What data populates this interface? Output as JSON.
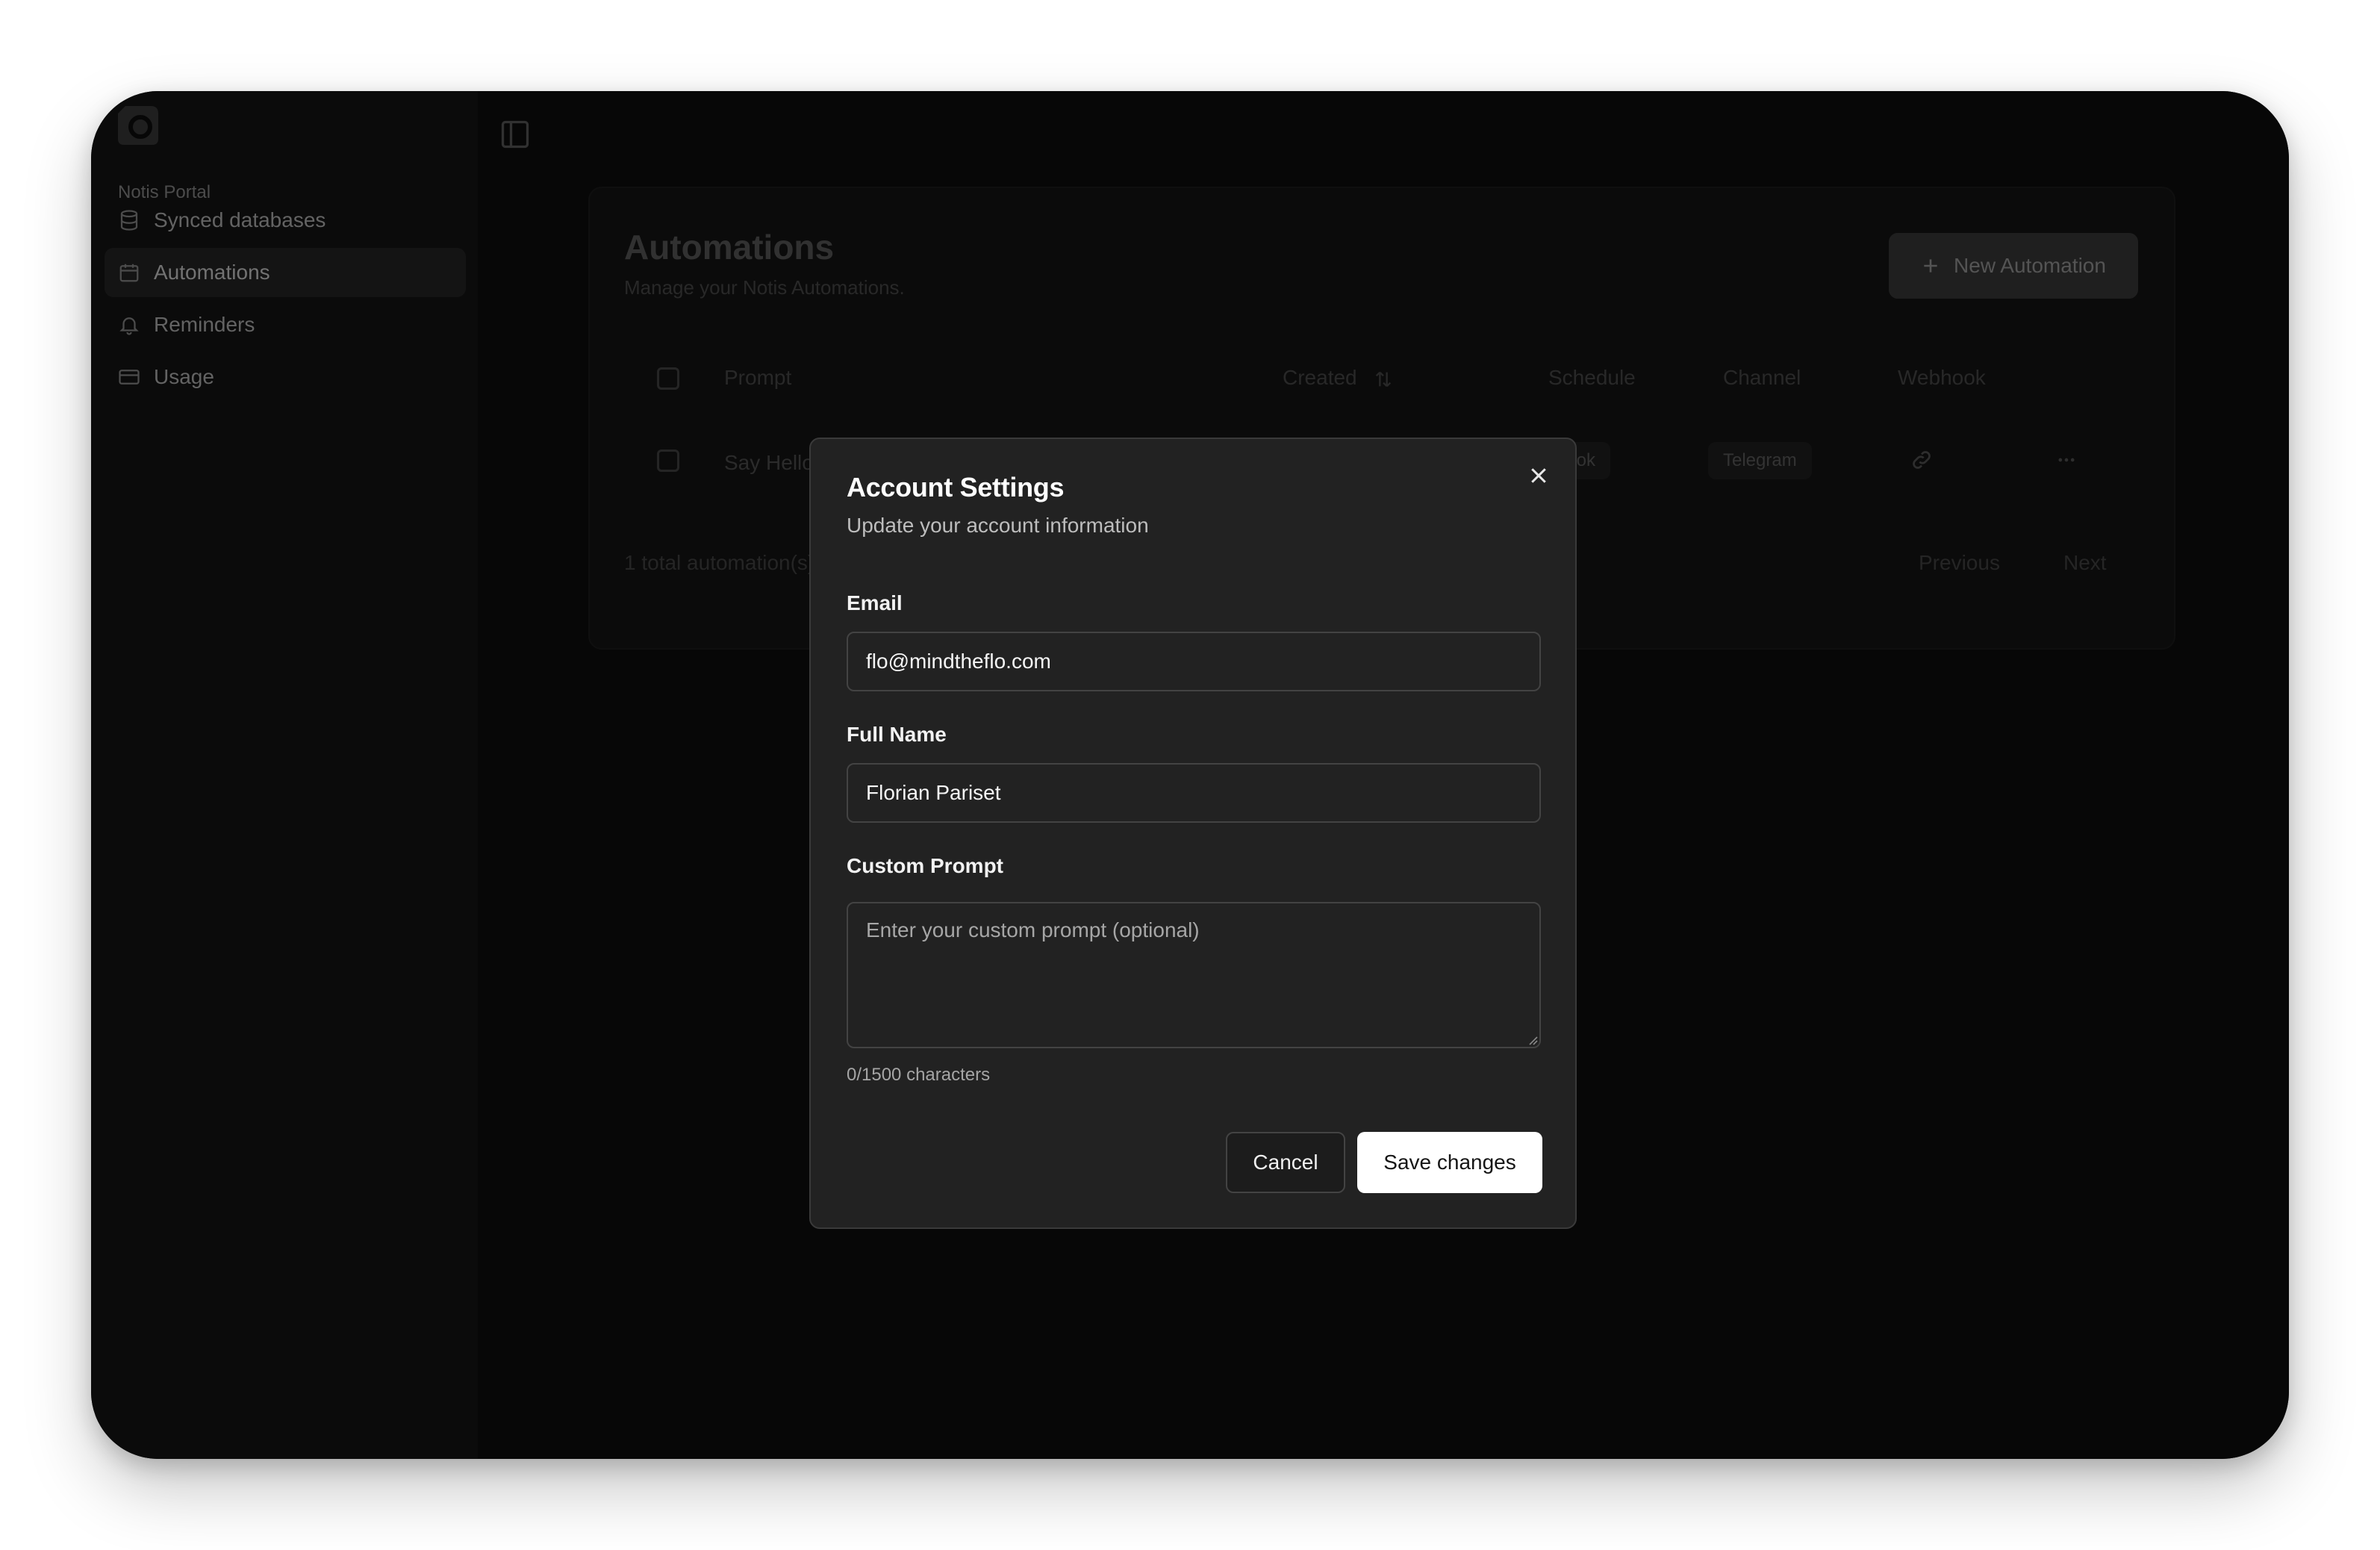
{
  "sidebar": {
    "group_label": "Notis Portal",
    "items": [
      {
        "label": "Synced databases",
        "icon": "database-icon",
        "active": false
      },
      {
        "label": "Automations",
        "icon": "calendar-icon",
        "active": true
      },
      {
        "label": "Reminders",
        "icon": "bell-icon",
        "active": false
      },
      {
        "label": "Usage",
        "icon": "credit-card-icon",
        "active": false
      }
    ]
  },
  "main": {
    "title": "Automations",
    "subtitle": "Manage your Notis Automations.",
    "new_button_label": "New Automation",
    "table": {
      "headers": {
        "prompt": "Prompt",
        "created": "Created",
        "schedule": "Schedule",
        "channel": "Channel",
        "webhook": "Webhook"
      },
      "rows": [
        {
          "prompt": "Say Hello",
          "schedule": "Webhook",
          "channel": "Telegram"
        }
      ]
    },
    "footer": {
      "total": "1 total automation(s)",
      "previous": "Previous",
      "next": "Next"
    }
  },
  "modal": {
    "title": "Account Settings",
    "subtitle": "Update your account information",
    "email_label": "Email",
    "email_value": "flo@mindtheflo.com",
    "name_label": "Full Name",
    "name_value": "Florian Pariset",
    "prompt_label": "Custom Prompt",
    "prompt_placeholder": "Enter your custom prompt (optional)",
    "char_count": "0/1500 characters",
    "cancel_label": "Cancel",
    "save_label": "Save changes"
  },
  "colors": {
    "window_bg": "#0b0b0b",
    "modal_bg": "#222222",
    "primary_button": "#ffffff"
  }
}
